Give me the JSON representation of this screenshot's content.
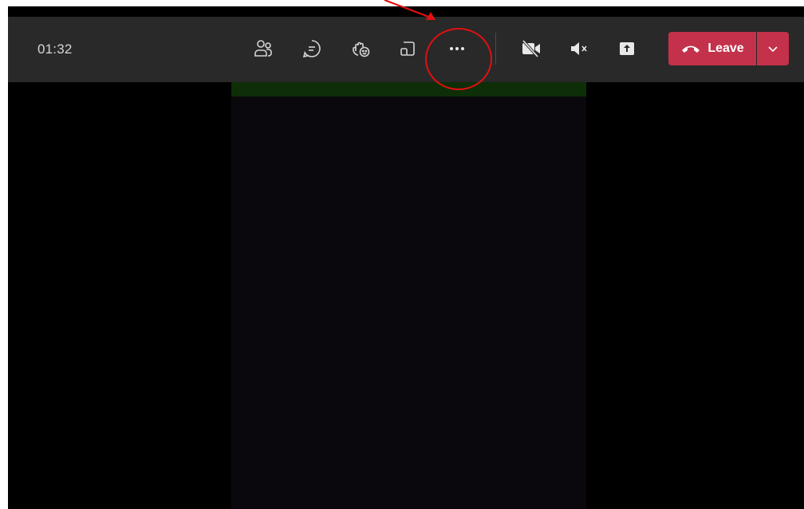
{
  "call_toolbar": {
    "timer": "01:32",
    "buttons": [
      {
        "name": "people-icon"
      },
      {
        "name": "chat-icon"
      },
      {
        "name": "react-icon"
      },
      {
        "name": "rooms-icon"
      },
      {
        "name": "more-actions-icon"
      },
      {
        "name": "camera-off-icon"
      },
      {
        "name": "mic-muted-icon"
      },
      {
        "name": "share-screen-icon"
      }
    ],
    "leave_label": "Leave",
    "leave_color": "#c4314b",
    "toolbar_color": "#292929"
  },
  "annotation": {
    "color": "#e01010",
    "target": "more-actions-icon"
  }
}
